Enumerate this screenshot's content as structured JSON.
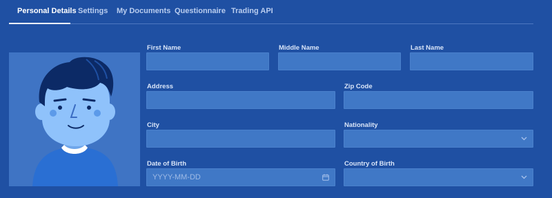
{
  "tabs": [
    {
      "label": "Personal Details",
      "active": true
    },
    {
      "label": "Settings",
      "active": false
    },
    {
      "label": "My Documents",
      "active": false
    },
    {
      "label": "Questionnaire",
      "active": false
    },
    {
      "label": "Trading API",
      "active": false
    }
  ],
  "form": {
    "first_name": {
      "label": "First Name",
      "value": ""
    },
    "middle_name": {
      "label": "Middle Name",
      "value": ""
    },
    "last_name": {
      "label": "Last Name",
      "value": ""
    },
    "address": {
      "label": "Address",
      "value": ""
    },
    "zip_code": {
      "label": "Zip Code",
      "value": ""
    },
    "city": {
      "label": "City",
      "value": ""
    },
    "nationality": {
      "label": "Nationality",
      "selected": "",
      "icon": "chevron-down-icon"
    },
    "date_of_birth": {
      "label": "Date of Birth",
      "placeholder": "YYYY-MM-DD",
      "icon": "calendar-icon"
    },
    "country_of_birth": {
      "label": "Country of Birth",
      "selected": "",
      "icon": "chevron-down-icon"
    }
  },
  "colors": {
    "background": "#1f50a3",
    "field": "#4078c6",
    "avatar_panel": "#3f74c4",
    "skin": "#8fc2fb",
    "hair": "#0c2a66",
    "shirt": "#2a6fd3"
  }
}
